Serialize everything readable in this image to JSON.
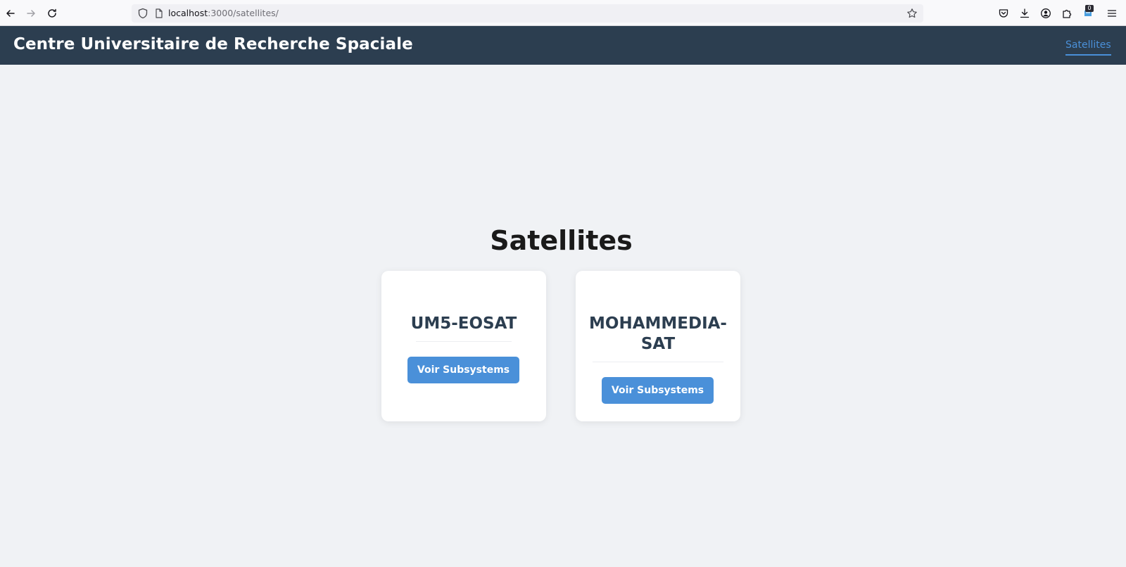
{
  "browser": {
    "url_host": "localhost",
    "url_path": ":3000/satellites/",
    "extension_badge": "0"
  },
  "header": {
    "title": "Centre Universitaire de Recherche Spaciale",
    "nav_link": "Satellites"
  },
  "main": {
    "title": "Satellites",
    "cards": [
      {
        "name": "UM5-EOSAT",
        "button_label": "Voir Subsystems"
      },
      {
        "name_line1": "MOHAMMEDIA-",
        "name_line2": "SAT",
        "button_label": "Voir Subsystems"
      }
    ]
  },
  "colors": {
    "header_bg": "#2c3e50",
    "accent": "#4a90d9",
    "page_bg": "#f0f2f5",
    "card_title": "#2c3e50"
  }
}
